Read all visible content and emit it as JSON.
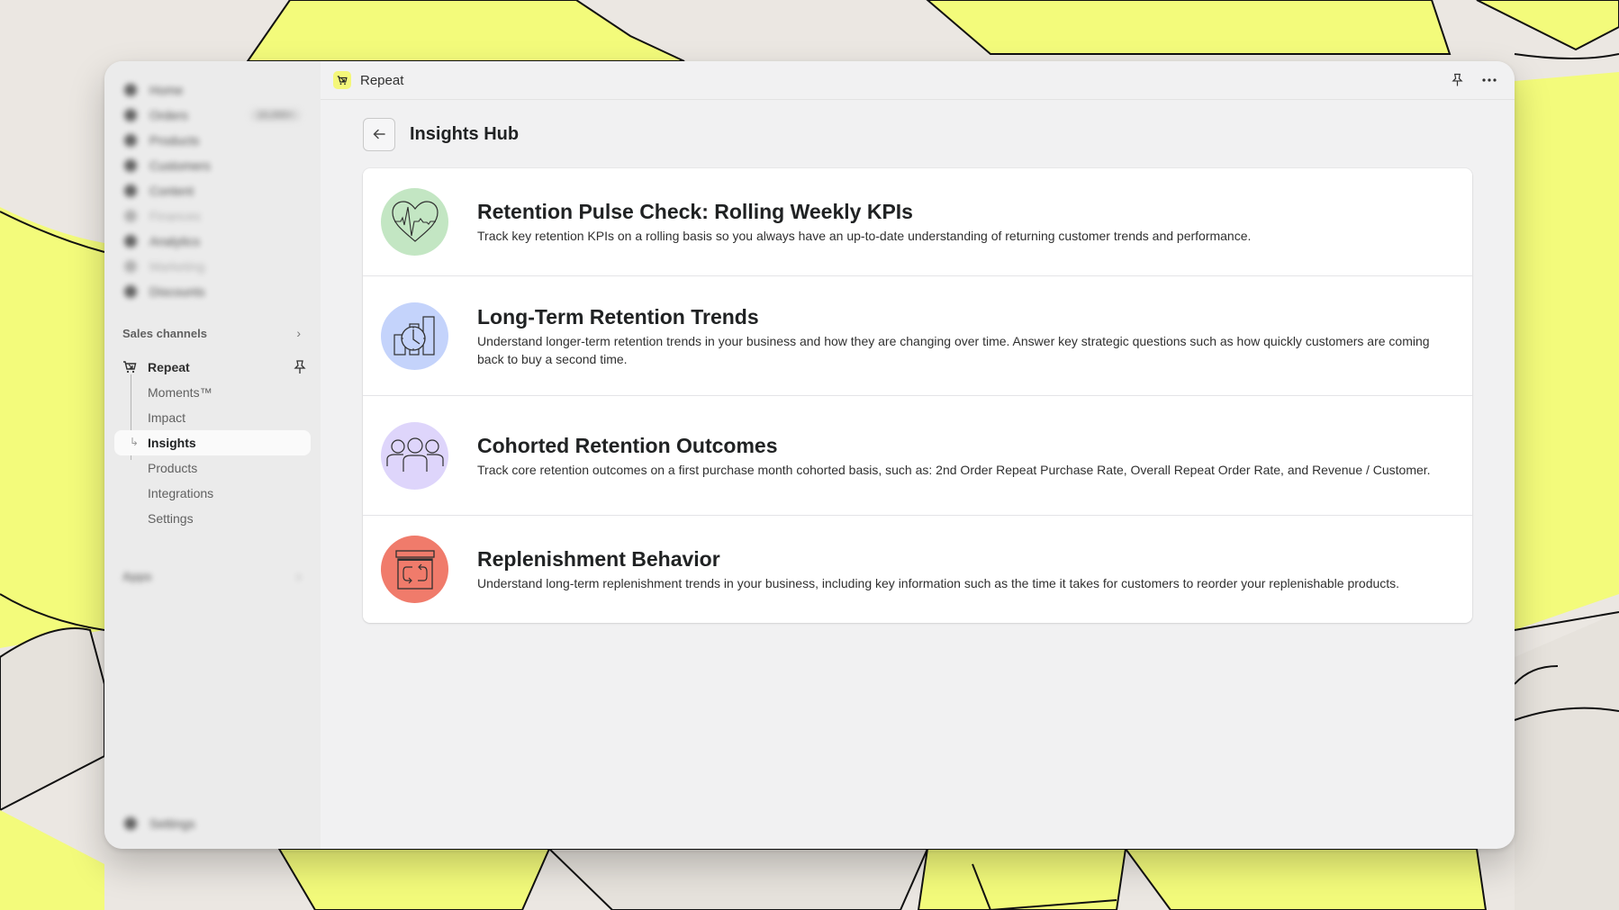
{
  "app": {
    "name": "Repeat",
    "logo_color": "#f4f77a"
  },
  "sidebar": {
    "blurred_items": [
      {
        "label": "Home",
        "faint": false
      },
      {
        "label": "Orders",
        "badge": "10,000+",
        "faint": false
      },
      {
        "label": "Products",
        "faint": false
      },
      {
        "label": "Customers",
        "faint": false
      },
      {
        "label": "Content",
        "faint": false
      },
      {
        "label": "Finances",
        "faint": true
      },
      {
        "label": "Analytics",
        "faint": false
      },
      {
        "label": "Marketing",
        "faint": true
      },
      {
        "label": "Discounts",
        "faint": false
      }
    ],
    "sales_channels_label": "Sales channels",
    "channel": {
      "label": "Repeat",
      "sub_items": [
        {
          "label": "Moments™",
          "active": false
        },
        {
          "label": "Impact",
          "active": false
        },
        {
          "label": "Insights",
          "active": true
        },
        {
          "label": "Products",
          "active": false
        },
        {
          "label": "Integrations",
          "active": false
        },
        {
          "label": "Settings",
          "active": false
        }
      ]
    },
    "apps_label": "Apps",
    "settings_label": "Settings"
  },
  "topbar": {
    "title": "Repeat",
    "pin_icon": "pin-icon",
    "more_icon": "more-horizontal-icon"
  },
  "page": {
    "title": "Insights Hub",
    "back_icon": "arrow-left-icon"
  },
  "insights": [
    {
      "title": "Retention Pulse Check: Rolling Weekly KPIs",
      "description": "Track key retention KPIs on a rolling basis so you always have an up-to-date understanding of returning customer trends and performance.",
      "icon": "heart-pulse-icon",
      "color": "#c3e6c3"
    },
    {
      "title": "Long-Term Retention Trends",
      "description": "Understand longer-term retention trends in your business and how they are changing over time. Answer key strategic questions such as how quickly customers are coming back to buy a second time.",
      "icon": "clock-chart-icon",
      "color": "#c4d3fb"
    },
    {
      "title": "Cohorted Retention Outcomes",
      "description": "Track core retention outcomes on a first purchase month cohorted basis, such as: 2nd Order Repeat Purchase Rate, Overall Repeat Order Rate, and Revenue / Customer.",
      "icon": "users-group-icon",
      "color": "#ded5fb"
    },
    {
      "title": "Replenishment Behavior",
      "description": "Understand long-term replenishment trends in your business, including key information such as the time it takes for customers to reorder your replenishable products.",
      "icon": "box-refresh-icon",
      "color": "#f07b6b"
    }
  ]
}
